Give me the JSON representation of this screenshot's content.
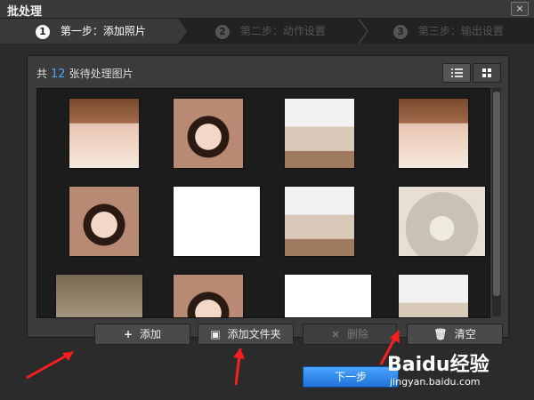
{
  "window": {
    "title": "批处理",
    "close_label": "×"
  },
  "steps": [
    {
      "num": "1",
      "label": "第一步：添加照片",
      "active": true
    },
    {
      "num": "2",
      "label": "第二步：动作设置",
      "active": false
    },
    {
      "num": "3",
      "label": "第三步：输出设置",
      "active": false
    }
  ],
  "gallery": {
    "count_prefix": "共",
    "count": "12",
    "count_suffix": "张待处理图片",
    "view_modes": [
      "list-icon",
      "grid-icon"
    ],
    "images": [
      {
        "name": "portrait-1",
        "style": "portrait"
      },
      {
        "name": "portrait-2",
        "style": "face"
      },
      {
        "name": "portrait-3",
        "style": "bw"
      },
      {
        "name": "portrait-4",
        "style": "portrait"
      },
      {
        "name": "portrait-5",
        "style": "face"
      },
      {
        "name": "cartoon-1",
        "style": "cartoon"
      },
      {
        "name": "portrait-6",
        "style": "bw"
      },
      {
        "name": "compass-1",
        "style": "compass"
      },
      {
        "name": "dog-1",
        "style": "dog"
      },
      {
        "name": "portrait-7",
        "style": "face"
      },
      {
        "name": "cartoon-2",
        "style": "cartoon"
      },
      {
        "name": "portrait-8",
        "style": "bw"
      }
    ]
  },
  "actions": {
    "add": {
      "icon": "plus-icon",
      "label": "添加"
    },
    "add_folder": {
      "icon": "folder-add-icon",
      "label": "添加文件夹"
    },
    "delete": {
      "icon": "x-icon",
      "label": "删除"
    },
    "clear": {
      "icon": "trash-icon",
      "label": "清空"
    }
  },
  "footer": {
    "next_label": "下一步"
  },
  "watermark": {
    "brand": "Baidu经验",
    "url": "jingyan.baidu.com"
  },
  "colors": {
    "accent": "#4aa3ff",
    "arrow_red": "#ff1e1e"
  }
}
